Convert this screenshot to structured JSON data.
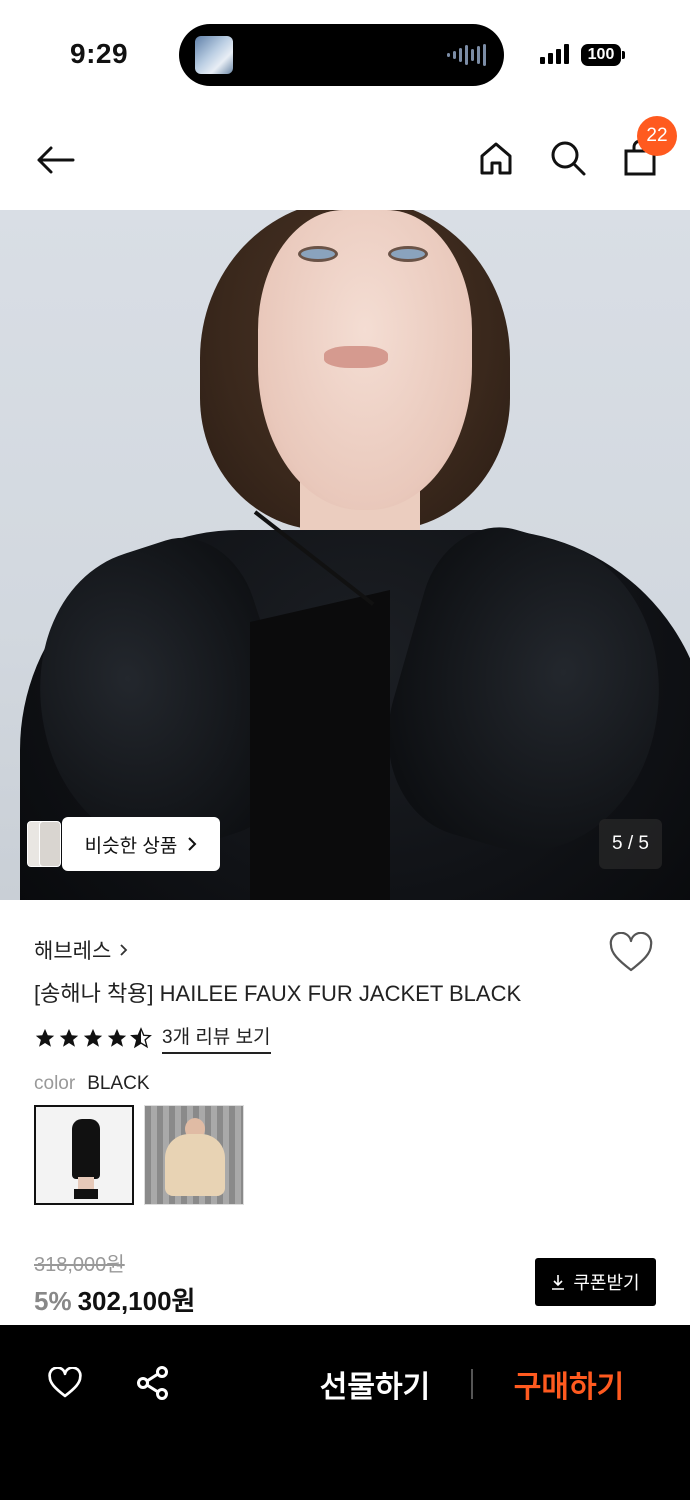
{
  "status_bar": {
    "time": "9:29",
    "battery": "100"
  },
  "nav": {
    "icons": [
      "back-arrow-icon",
      "home-icon",
      "search-icon",
      "shopping-bag-icon"
    ],
    "cart_count": "22",
    "badge_color": "#ff5a1f"
  },
  "gallery": {
    "similar_label": "비슷한 상품",
    "page_indicator": "5 / 5",
    "current_page": 5,
    "total_pages": 5
  },
  "product": {
    "brand": "해브레스",
    "title": "[송해나 착용] HAILEE FAUX FUR JACKET BLACK",
    "rating": 4.5,
    "review_link": "3개 리뷰 보기",
    "color_label": "color",
    "color_value": "BLACK",
    "swatches": [
      "black-fur-jacket",
      "beige-fur-jacket"
    ],
    "original_price": "318,000원",
    "discount": "5%",
    "sale_price": "302,100원",
    "coupon_label": "쿠폰받기"
  },
  "bottom_bar": {
    "gift_label": "선물하기",
    "buy_label": "구매하기",
    "buy_color": "#ff5a1f"
  }
}
